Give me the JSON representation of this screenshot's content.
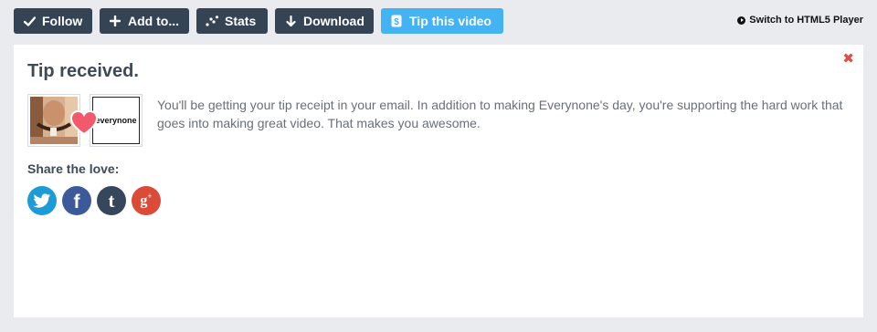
{
  "toolbar": {
    "follow_label": "Follow",
    "add_label": "Add to...",
    "stats_label": "Stats",
    "download_label": "Download",
    "tip_label": "Tip this video",
    "switch_label": "Switch to HTML5 Player"
  },
  "panel": {
    "title": "Tip received.",
    "message": "You'll be getting your tip receipt in your email. In addition to making Everynone's day, you're supporting the hard work that goes into making great video. That makes you awesome.",
    "share_label": "Share the love:",
    "close_glyph": "✖",
    "creator_logo_text": "everynone"
  },
  "social": {
    "items": [
      {
        "name": "twitter-icon",
        "color": "#1d9bd6"
      },
      {
        "name": "facebook-icon",
        "color": "#3c5a99"
      },
      {
        "name": "tumblr-icon",
        "color": "#36465d"
      },
      {
        "name": "google-plus-icon",
        "color": "#dc4a38"
      }
    ]
  },
  "colors": {
    "button_dark": "#354455",
    "button_tip": "#43b3f3",
    "close": "#e8483f",
    "heart": "#f25a6b",
    "title_text": "#3e4a59",
    "body_text": "#6a6f76",
    "page_background": "#e9ebee"
  }
}
